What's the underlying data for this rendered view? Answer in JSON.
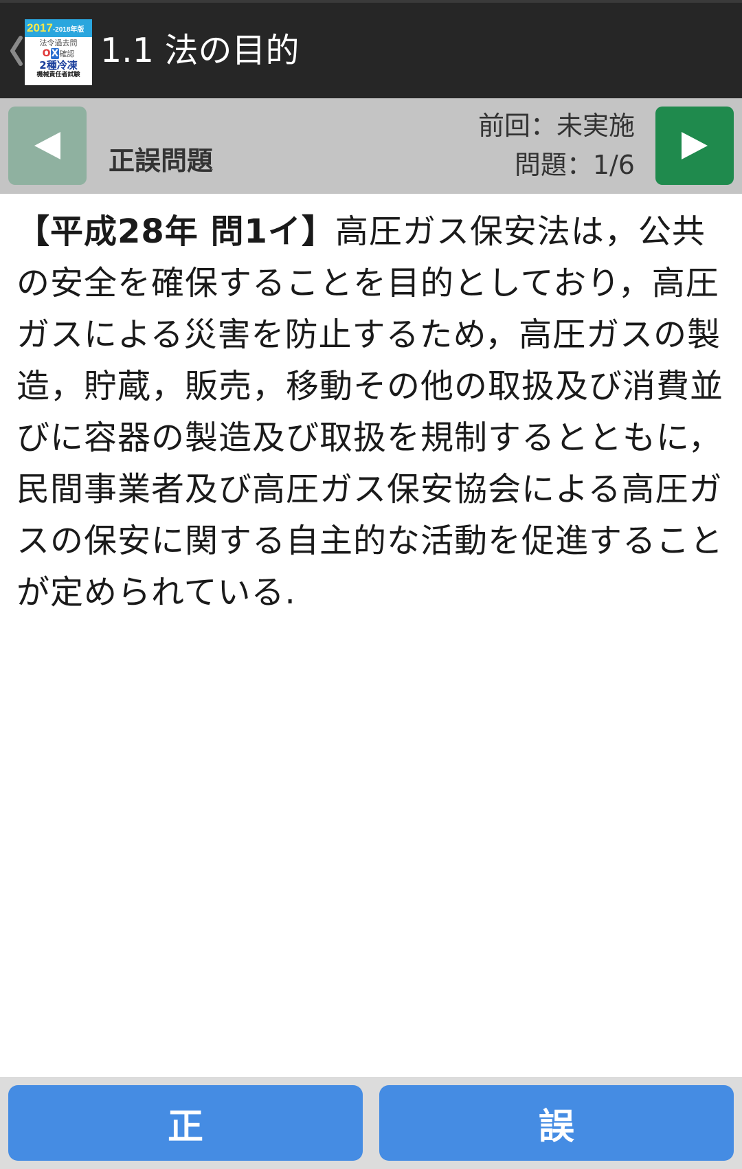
{
  "action_bar": {
    "title": "1.1 法の目的",
    "up_icon": "chevron-left-icon",
    "logo": {
      "year_main": "2017",
      "year_suffix": "-2018年版",
      "line1": "法令過去問",
      "ox_o": "O",
      "ox_x": "X",
      "line2": "確認",
      "line3": "2種冷凍",
      "line4": "機械責任者試験"
    }
  },
  "question_header": {
    "prev_icon": "triangle-left-icon",
    "next_icon": "triangle-right-icon",
    "type_label": "正誤問題",
    "previous_result": "前回：未実施",
    "progress": "問題：1/6"
  },
  "question": {
    "tag": "【平成28年 問1イ】",
    "text": "高圧ガス保安法は，公共の安全を確保することを目的としており，高圧ガスによる災害を防止するため，高圧ガスの製造，貯蔵，販売，移動その他の取扱及び消費並びに容器の製造及び取扱を規制するとともに，民間事業者及び高圧ガス保安協会による高圧ガスの保安に関する自主的な活動を促進することが定められている."
  },
  "answers": {
    "true_label": "正",
    "false_label": "誤"
  },
  "colors": {
    "action_bar_bg": "#262626",
    "header_bg": "#c4c4c4",
    "prev_button": "#8fb1a0",
    "next_button": "#1f8a4d",
    "answer_button": "#458ce3"
  }
}
